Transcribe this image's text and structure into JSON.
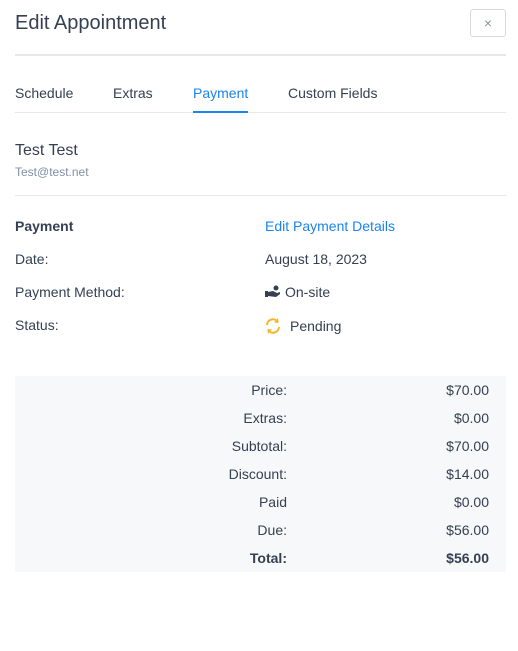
{
  "header": {
    "title": "Edit Appointment",
    "close_label": "×"
  },
  "tabs": [
    {
      "label": "Schedule",
      "active": false
    },
    {
      "label": "Extras",
      "active": false
    },
    {
      "label": "Payment",
      "active": true
    },
    {
      "label": "Custom Fields",
      "active": false
    }
  ],
  "customer": {
    "name": "Test Test",
    "email": "Test@test.net"
  },
  "payment": {
    "heading": "Payment",
    "edit_link": "Edit Payment Details",
    "date_label": "Date:",
    "date_value": "August 18, 2023",
    "method_label": "Payment Method:",
    "method_value": "On-site",
    "method_icon": "hand-money-icon",
    "status_label": "Status:",
    "status_value": "Pending",
    "status_icon": "sync-icon",
    "status_color": "#f3b82a"
  },
  "summary": {
    "rows": [
      {
        "label": "Price:",
        "value": "$70.00"
      },
      {
        "label": "Extras:",
        "value": "$0.00"
      },
      {
        "label": "Subtotal:",
        "value": "$70.00"
      },
      {
        "label": "Discount:",
        "value": "$14.00"
      },
      {
        "label": "Paid",
        "value": "$0.00"
      },
      {
        "label": "Due:",
        "value": "$56.00"
      },
      {
        "label": "Total:",
        "value": "$56.00"
      }
    ]
  },
  "colors": {
    "accent": "#1a84ee",
    "text": "#354052",
    "muted": "#7f8fa4",
    "summary_bg": "#f7f8f9"
  }
}
